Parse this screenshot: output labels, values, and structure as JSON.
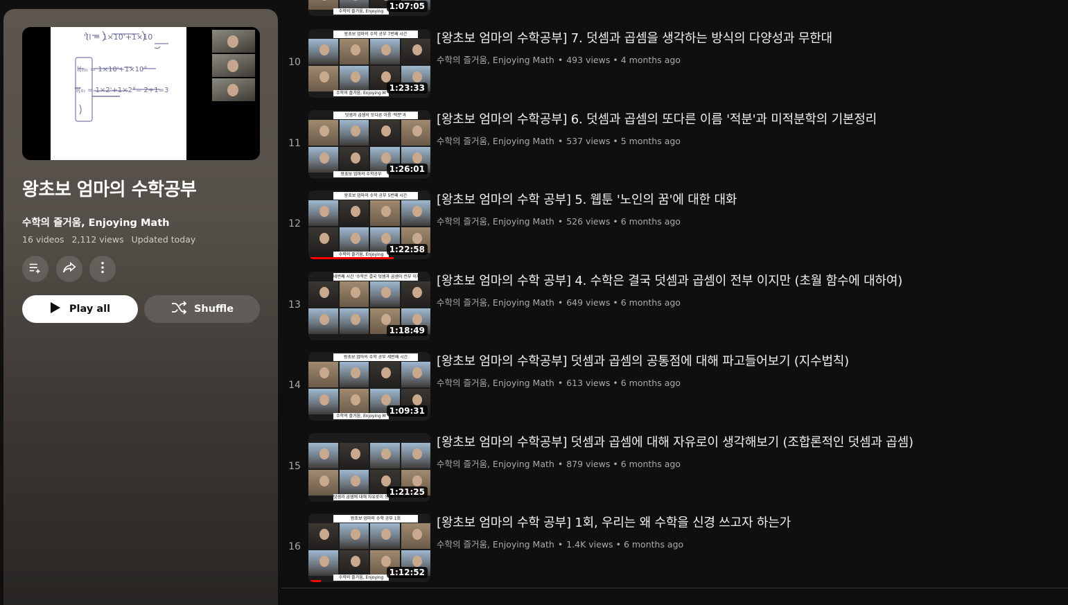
{
  "playlist": {
    "title": "왕초보 엄마의 수학공부",
    "owner": "수학의 즐거움, Enjoying Math",
    "video_count": "16 videos",
    "views": "2,112 views",
    "updated": "Updated today",
    "play_all_label": "Play all",
    "shuffle_label": "Shuffle",
    "cover_icon": "whiteboard-thumbnail"
  },
  "top_partial_row": {
    "duration": "1:07:05",
    "footer_text": "수학의 즐거움, Enjoying"
  },
  "videos": [
    {
      "index": "10",
      "title": "[왕초보 엄마의 수학공부] 7. 덧셈과 곱셈을 생각하는 방식의 다양성과 무한대",
      "channel": "수학의 즐거움, Enjoying Math",
      "views": "493 views",
      "age": "4 months ago",
      "duration": "1:23:33",
      "banner": "왕초보 엄마의 수학 공부 7번째 시간",
      "footer": "수학의 즐거움, Enjoying M",
      "watched": 0
    },
    {
      "index": "11",
      "title": "[왕초보 엄마의 수학공부] 6. 덧셈과 곱셈의 또다른 이름 '적분'과 미적분학의 기본정리",
      "channel": "수학의 즐거움, Enjoying Math",
      "views": "537 views",
      "age": "5 months ago",
      "duration": "1:26:01",
      "banner": "덧셈과 곱셈의 또다른 이름 '적분'과",
      "footer": "왕초보 엄마의 수학공부",
      "watched": 0
    },
    {
      "index": "12",
      "title": "[왕초보 엄마의 수학 공부] 5. 웹툰 '노인의 꿈'에 대한 대화",
      "channel": "수학의 즐거움, Enjoying Math",
      "views": "526 views",
      "age": "6 months ago",
      "duration": "1:22:58",
      "banner": "왕초보 엄마의 수학 공부 5번째 시간",
      "footer": "수학의 즐거움, Enjoying",
      "watched": 0.7
    },
    {
      "index": "13",
      "title": "[왕초보 엄마의 수학 공부] 4. 수학은 결국 덧셈과 곱셈이 전부 이지만 (초월 함수에 대하여)",
      "channel": "수학의 즐거움, Enjoying Math",
      "views": "649 views",
      "age": "6 months ago",
      "duration": "1:18:49",
      "banner": "네번째 시간 '수학은 결국 덧셈과 곱셈이 전부 이지만'",
      "footer": "",
      "watched": 0
    },
    {
      "index": "14",
      "title": "[왕초보 엄마의 수학공부] 덧셈과 곱셈의 공통점에 대해 파고들어보기 (지수법칙)",
      "channel": "수학의 즐거움, Enjoying Math",
      "views": "613 views",
      "age": "6 months ago",
      "duration": "1:09:31",
      "banner": "왕초보 엄마의 수학 공부 세번째 시간",
      "footer": "수학의 즐거움, Enjoying M",
      "watched": 0
    },
    {
      "index": "15",
      "title": "[왕초보 엄마의 수학공부] 덧셈과 곱셈에 대해 자유로이 생각해보기 (조합론적인 덧셈과 곱셈)",
      "channel": "수학의 즐거움, Enjoying Math",
      "views": "879 views",
      "age": "6 months ago",
      "duration": "1:21:25",
      "banner": "",
      "footer": "덧셈과 곱셈에 대해 자유로이 생각해보기",
      "watched": 0
    },
    {
      "index": "16",
      "title": "[왕초보 엄마의 수학 공부] 1회, 우리는 왜 수학을 신경 쓰고자 하는가",
      "channel": "수학의 즐거움, Enjoying Math",
      "views": "1.4K views",
      "age": "6 months ago",
      "duration": "1:12:52",
      "banner": "왕초보 엄마의 수학 공부 1회",
      "footer": "수학의 즐거움, Enjoying",
      "watched": 0.1
    }
  ],
  "meta_separator": "•",
  "colors": {
    "background": "#0f0f0f",
    "panel_top": "#5d564f",
    "progress": "#ff0000",
    "secondary_text": "#aaaaaa"
  }
}
